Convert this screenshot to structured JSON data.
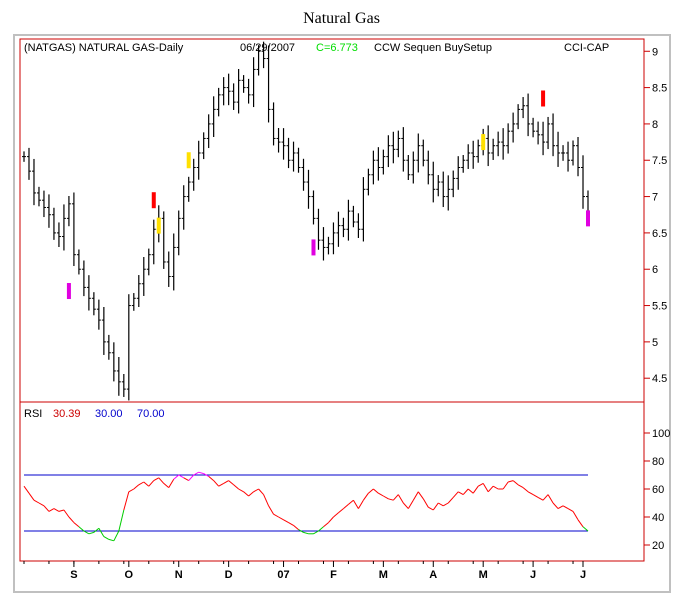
{
  "page": {
    "title": "Natural Gas"
  },
  "header": {
    "symbol": "(NATGAS) NATURAL GAS-Daily",
    "date": "06/29/2007",
    "close": "C=6.773",
    "study": "CCW Sequen BuySetup",
    "tag": "CCI-CAP"
  },
  "rsi_header": {
    "label": "RSI",
    "value": "30.39",
    "lower": "30.00",
    "upper": "70.00"
  },
  "colors": {
    "background": "#ffffff",
    "frame": "#c0c0c0",
    "axis": "#cc0000",
    "price_bar": "#000000",
    "rsi_line": "#ff0000",
    "rsi_oversold": "#00cc00",
    "rsi_overbought": "#ff00ff",
    "bands": "#0000cc",
    "close_text": "#00dd00",
    "rsi_value_text": "#cc0000",
    "rsi_band_text": "#0000cc",
    "marker_red": "#ff0000",
    "marker_yellow": "#ffe000",
    "marker_magenta": "#e000e0"
  },
  "chart_data": [
    {
      "type": "ohlc",
      "ylim": [
        4.2,
        9.1
      ],
      "y_ticks": [
        {
          "value": 4.5,
          "label": "4.5"
        },
        {
          "value": 5,
          "label": "5"
        },
        {
          "value": 5.5,
          "label": "5.5"
        },
        {
          "value": 6,
          "label": "6"
        },
        {
          "value": 6.5,
          "label": "6.5"
        },
        {
          "value": 7,
          "label": "7"
        },
        {
          "value": 7.5,
          "label": "7.5"
        },
        {
          "value": 8,
          "label": "8"
        },
        {
          "value": 8.5,
          "label": "8.5"
        },
        {
          "value": 9,
          "label": "9"
        }
      ],
      "x_ticks": [
        "S",
        "O",
        "N",
        "D",
        "07",
        "F",
        "M",
        "A",
        "M",
        "J",
        "J"
      ],
      "x_tick_index": [
        10,
        21,
        31,
        41,
        52,
        62,
        72,
        82,
        92,
        102,
        112
      ],
      "n_bars": 114,
      "close": [
        7.55,
        7.35,
        7.05,
        6.95,
        6.85,
        6.75,
        6.5,
        6.45,
        6.7,
        6.9,
        6.2,
        6.0,
        5.75,
        5.6,
        5.45,
        5.3,
        5.0,
        4.85,
        4.6,
        4.45,
        4.35,
        5.5,
        5.6,
        5.8,
        6.0,
        6.2,
        6.55,
        6.7,
        6.1,
        5.9,
        6.3,
        6.7,
        7.0,
        7.2,
        7.4,
        7.6,
        7.8,
        8.0,
        8.2,
        8.4,
        8.5,
        8.45,
        8.3,
        8.6,
        8.5,
        8.4,
        8.75,
        9.0,
        8.9,
        8.2,
        7.8,
        7.75,
        7.7,
        7.5,
        7.6,
        7.4,
        7.2,
        7.0,
        6.7,
        6.4,
        6.3,
        6.35,
        6.5,
        6.6,
        6.55,
        6.8,
        6.65,
        6.55,
        7.1,
        7.3,
        7.5,
        7.4,
        7.55,
        7.7,
        7.65,
        7.8,
        7.5,
        7.3,
        7.5,
        7.7,
        7.5,
        7.3,
        7.1,
        7.2,
        7.0,
        7.1,
        7.25,
        7.4,
        7.5,
        7.6,
        7.55,
        7.7,
        7.8,
        7.6,
        7.7,
        7.75,
        7.7,
        7.9,
        8.0,
        8.2,
        8.25,
        8.0,
        7.9,
        7.85,
        7.75,
        8.0,
        7.7,
        7.6,
        7.6,
        7.5,
        7.7,
        7.4,
        7.0,
        6.77
      ],
      "markers": [
        {
          "index": 9,
          "value": 5.7,
          "color": "magenta"
        },
        {
          "index": 27,
          "value": 6.6,
          "color": "yellow"
        },
        {
          "index": 26,
          "value": 6.95,
          "color": "red"
        },
        {
          "index": 33,
          "value": 7.5,
          "color": "yellow"
        },
        {
          "index": 58,
          "value": 6.3,
          "color": "magenta"
        },
        {
          "index": 92,
          "value": 7.75,
          "color": "yellow"
        },
        {
          "index": 104,
          "value": 8.35,
          "color": "red"
        },
        {
          "index": 113,
          "value": 6.7,
          "color": "magenta"
        }
      ]
    },
    {
      "type": "line",
      "name": "RSI",
      "ylim": [
        10,
        105
      ],
      "y_ticks": [
        {
          "value": 20,
          "label": "20"
        },
        {
          "value": 40,
          "label": "40"
        },
        {
          "value": 60,
          "label": "60"
        },
        {
          "value": 80,
          "label": "80"
        },
        {
          "value": 100,
          "label": "100"
        }
      ],
      "bands": [
        30,
        70
      ],
      "values": [
        62,
        57,
        52,
        50,
        48,
        44,
        46,
        44,
        45,
        40,
        36,
        33,
        30,
        28,
        29,
        32,
        26,
        24,
        23,
        30,
        45,
        58,
        60,
        63,
        65,
        62,
        66,
        68,
        64,
        61,
        67,
        70,
        68,
        66,
        70,
        72,
        71,
        69,
        66,
        62,
        64,
        66,
        63,
        60,
        58,
        55,
        58,
        60,
        56,
        48,
        42,
        40,
        38,
        36,
        34,
        31,
        29,
        28,
        28,
        30,
        33,
        36,
        40,
        43,
        46,
        49,
        52,
        46,
        52,
        57,
        60,
        57,
        55,
        53,
        52,
        56,
        50,
        46,
        52,
        58,
        53,
        47,
        45,
        50,
        48,
        50,
        54,
        58,
        56,
        60,
        57,
        62,
        64,
        58,
        62,
        60,
        60,
        65,
        66,
        63,
        61,
        58,
        56,
        54,
        52,
        56,
        50,
        46,
        48,
        46,
        44,
        38,
        33,
        30
      ]
    }
  ]
}
